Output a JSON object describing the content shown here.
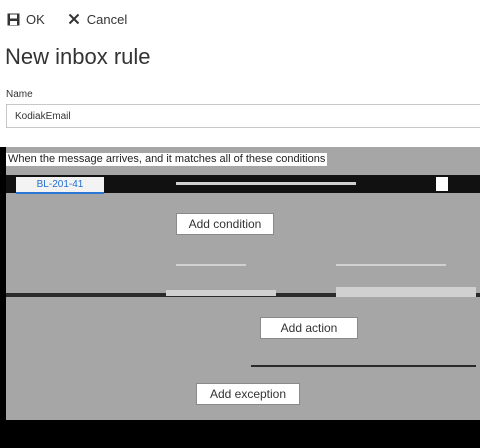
{
  "toolbar": {
    "ok_label": "OK",
    "cancel_label": "Cancel"
  },
  "page": {
    "title": "New inbox rule"
  },
  "name_field": {
    "label": "Name",
    "value": "KodiakEmail"
  },
  "conditions": {
    "heading": "When the message arrives, and it matches all of these conditions",
    "items": [
      {
        "label": "BL-201-41"
      }
    ],
    "add_label": "Add condition"
  },
  "actions": {
    "add_label": "Add action"
  },
  "exceptions": {
    "add_label": "Add exception"
  },
  "colors": {
    "accent": "#2b78d4",
    "panel_gray": "#a6a6a6",
    "background": "#ffffff"
  },
  "icons": {
    "ok": "save-icon",
    "cancel": "close-icon"
  }
}
